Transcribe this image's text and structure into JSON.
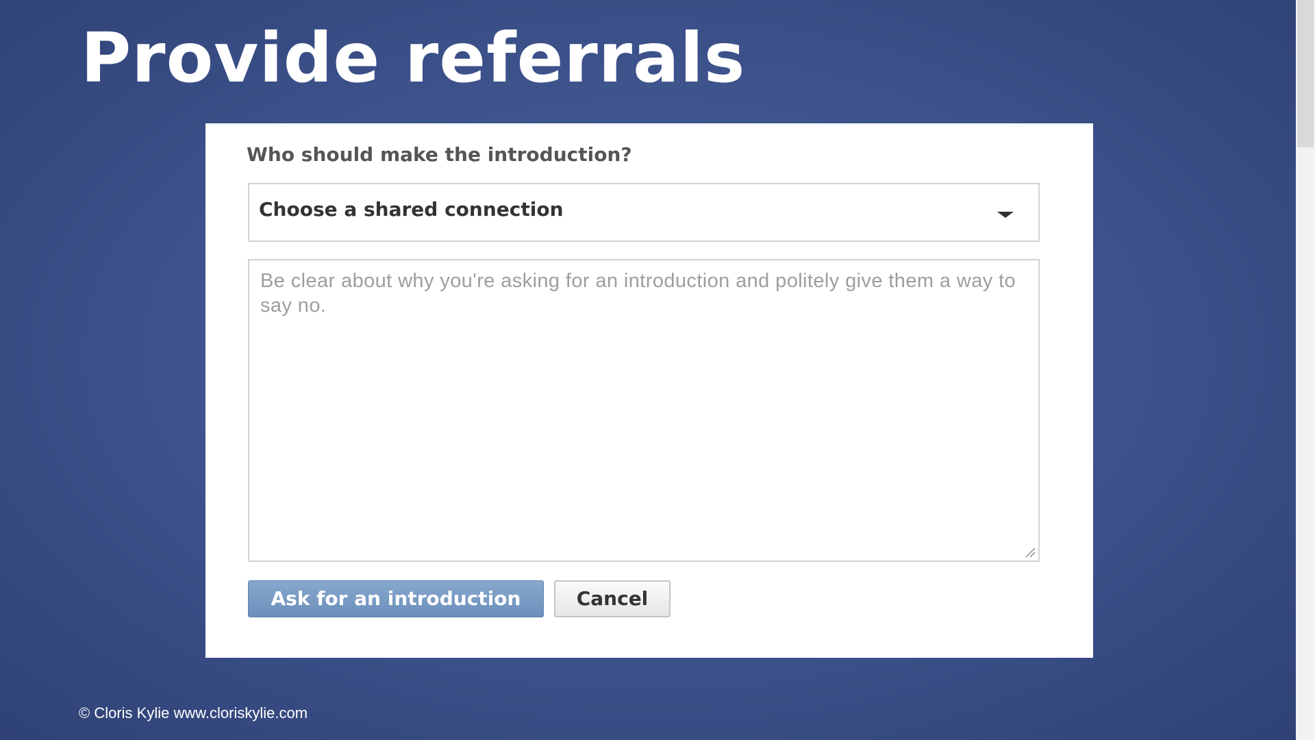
{
  "slide": {
    "title": "Provide referrals",
    "footer": "© Cloris Kylie www.cloriskylie.com"
  },
  "form": {
    "question": "Who should make the introduction?",
    "connection_select": {
      "selected": "Choose a shared connection",
      "icon": "chevron-down-icon"
    },
    "message": {
      "placeholder": "Be clear about why you're asking for an introduction and politely give them a way to say no.",
      "value": ""
    },
    "buttons": {
      "submit_label": "Ask for an introduction",
      "cancel_label": "Cancel"
    }
  },
  "colors": {
    "background": "#435993",
    "panel": "#ffffff",
    "primary_button": "#7799c4",
    "title_text": "#ffffff"
  }
}
